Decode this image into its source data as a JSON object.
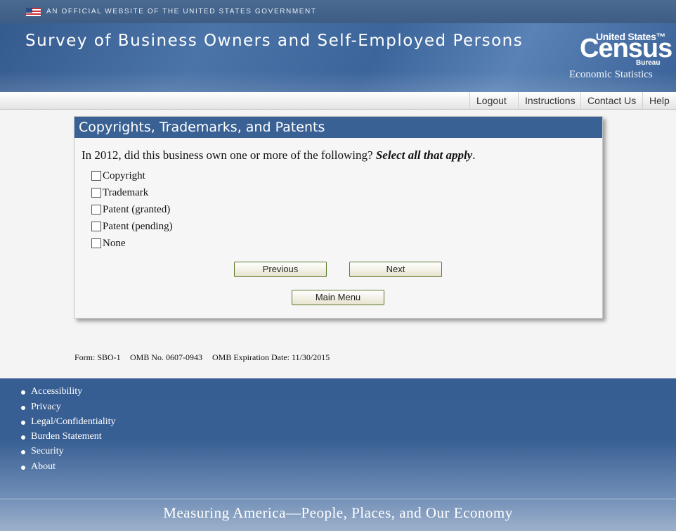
{
  "gov_banner": {
    "text": "AN OFFICIAL WEBSITE OF THE UNITED STATES GOVERNMENT",
    "icon": "us-flag-icon"
  },
  "header": {
    "title": "Survey of Business Owners and Self-Employed Persons",
    "logo": {
      "united_states": "United States™",
      "census": "Census",
      "bureau": "Bureau",
      "division": "Economic Statistics"
    }
  },
  "utility_nav": [
    "Logout",
    "Instructions",
    "Contact Us",
    "Help"
  ],
  "panel": {
    "title": "Copyrights, Trademarks, and Patents",
    "question": "In 2012, did this business own one or more of the following?",
    "question_emphasis": "Select all that apply",
    "question_end": ".",
    "options": [
      "Copyright",
      "Trademark",
      "Patent (granted)",
      "Patent (pending)",
      "None"
    ],
    "buttons": {
      "previous": "Previous",
      "next": "Next",
      "main_menu": "Main Menu"
    }
  },
  "form_info": {
    "form": "Form: SBO-1",
    "omb": "OMB No. 0607-0943",
    "expiration": "OMB Expiration Date: 11/30/2015"
  },
  "footer": {
    "links": [
      "Accessibility",
      "Privacy",
      "Legal/Confidentiality",
      "Burden Statement",
      "Security",
      "About"
    ],
    "tagline": "Measuring America—People, Places, and Our Economy"
  },
  "colors": {
    "header_blue": "#3a6194",
    "button_border": "#5a7a2a",
    "footer_blue": "#375e93"
  }
}
